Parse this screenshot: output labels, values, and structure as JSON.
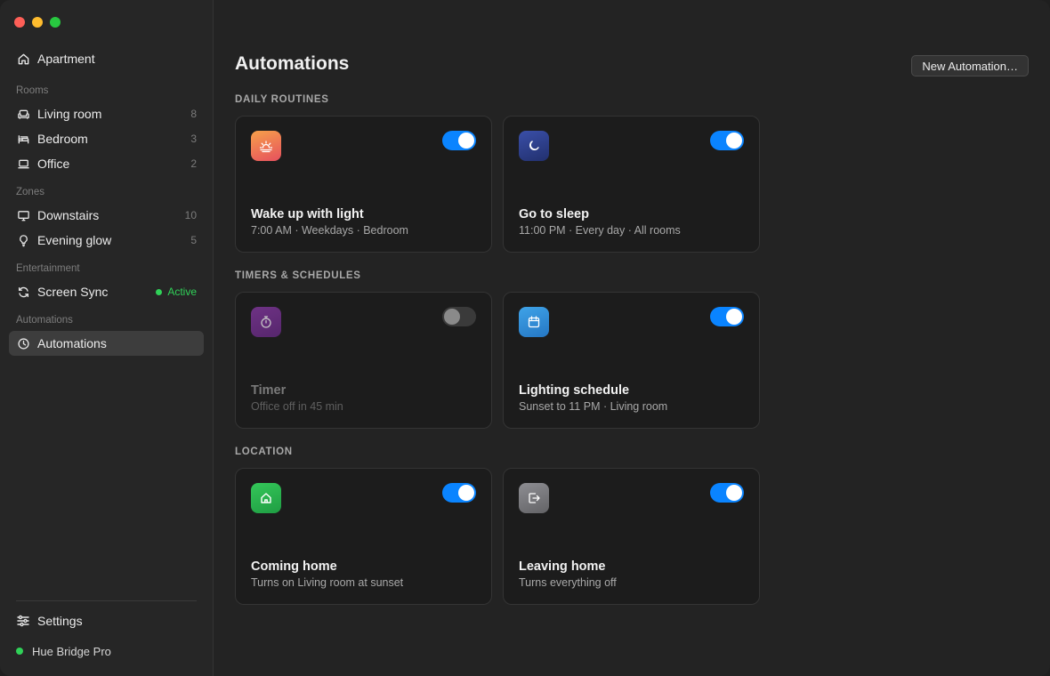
{
  "sidebar": {
    "home": {
      "label": "Apartment",
      "icon": "house-icon"
    },
    "sections": {
      "rooms": "Rooms",
      "zones": "Zones",
      "entertainment": "Entertainment",
      "automations": "Automations"
    },
    "rooms": [
      {
        "label": "Living room",
        "count": "8",
        "icon": "sofa-icon"
      },
      {
        "label": "Bedroom",
        "count": "3",
        "icon": "bed-icon"
      },
      {
        "label": "Office",
        "count": "2",
        "icon": "laptop-icon"
      }
    ],
    "zones": [
      {
        "label": "Downstairs",
        "count": "10",
        "icon": "monitor-icon"
      },
      {
        "label": "Evening glow",
        "count": "5",
        "icon": "bulb-icon"
      }
    ],
    "entertainment": [
      {
        "label": "Screen Sync",
        "status": "Active",
        "icon": "sync-icon"
      }
    ],
    "automations": [
      {
        "label": "Automations",
        "icon": "clock-icon",
        "selected": true
      }
    ],
    "footer": {
      "settings_label": "Settings",
      "bridge_label": "Hue Bridge Pro",
      "bridge_status_color": "#30d158"
    }
  },
  "main": {
    "title": "Automations",
    "new_button": "New Automation…",
    "groups": [
      {
        "label": "DAILY ROUTINES",
        "cards": [
          {
            "title": "Wake up with light",
            "subtitle": "7:00 AM · Weekdays · Bedroom",
            "enabled": true,
            "icon": "sunrise-icon",
            "tile_colors": [
              "#f7a14a",
              "#e6505e"
            ]
          },
          {
            "title": "Go to sleep",
            "subtitle": "11:00 PM · Every day · All rooms",
            "enabled": true,
            "icon": "moon-icon",
            "tile_colors": [
              "#3a4fa8",
              "#22306e"
            ]
          }
        ]
      },
      {
        "label": "TIMERS & SCHEDULES",
        "cards": [
          {
            "title": "Timer",
            "subtitle": "Office off in 45 min",
            "enabled": false,
            "icon": "stopwatch-icon",
            "tile_colors": [
              "#8a3aa8",
              "#6a2a88"
            ]
          },
          {
            "title": "Lighting schedule",
            "subtitle": "Sunset to 11 PM · Living room",
            "enabled": true,
            "icon": "calendar-icon",
            "tile_colors": [
              "#3fa3e8",
              "#2577c4"
            ]
          }
        ]
      },
      {
        "label": "LOCATION",
        "cards": [
          {
            "title": "Coming home",
            "subtitle": "Turns on Living room at sunset",
            "enabled": true,
            "icon": "house-icon",
            "tile_colors": [
              "#34c759",
              "#1f9d43"
            ]
          },
          {
            "title": "Leaving home",
            "subtitle": "Turns everything off",
            "enabled": true,
            "icon": "exit-icon",
            "tile_colors": [
              "#8e8e93",
              "#636366"
            ]
          }
        ]
      }
    ]
  },
  "colors": {
    "accent": "#0a84ff",
    "active_green": "#30d158"
  }
}
